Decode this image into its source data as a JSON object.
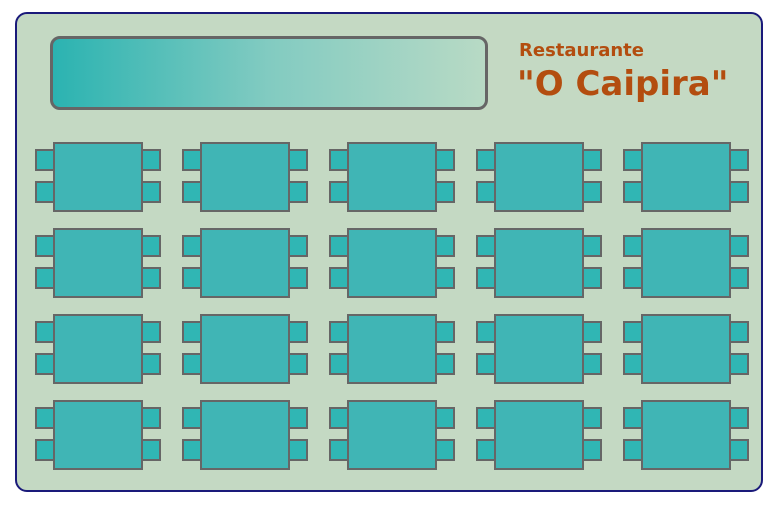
{
  "title": {
    "line1": "Restaurante",
    "line2": "\"O Caipira\""
  },
  "layout": {
    "rows": 4,
    "columns": 5,
    "chairs_per_table": 4
  },
  "colors": {
    "floor": "#c4d9c3",
    "floor_border": "#1a1a7a",
    "table": "#40b5b5",
    "chair": "#30b6b4",
    "outline": "#666666",
    "title": "#b34d0f",
    "counter_gradient_start": "#2bb3b1",
    "counter_gradient_end": "#b8dac5"
  }
}
